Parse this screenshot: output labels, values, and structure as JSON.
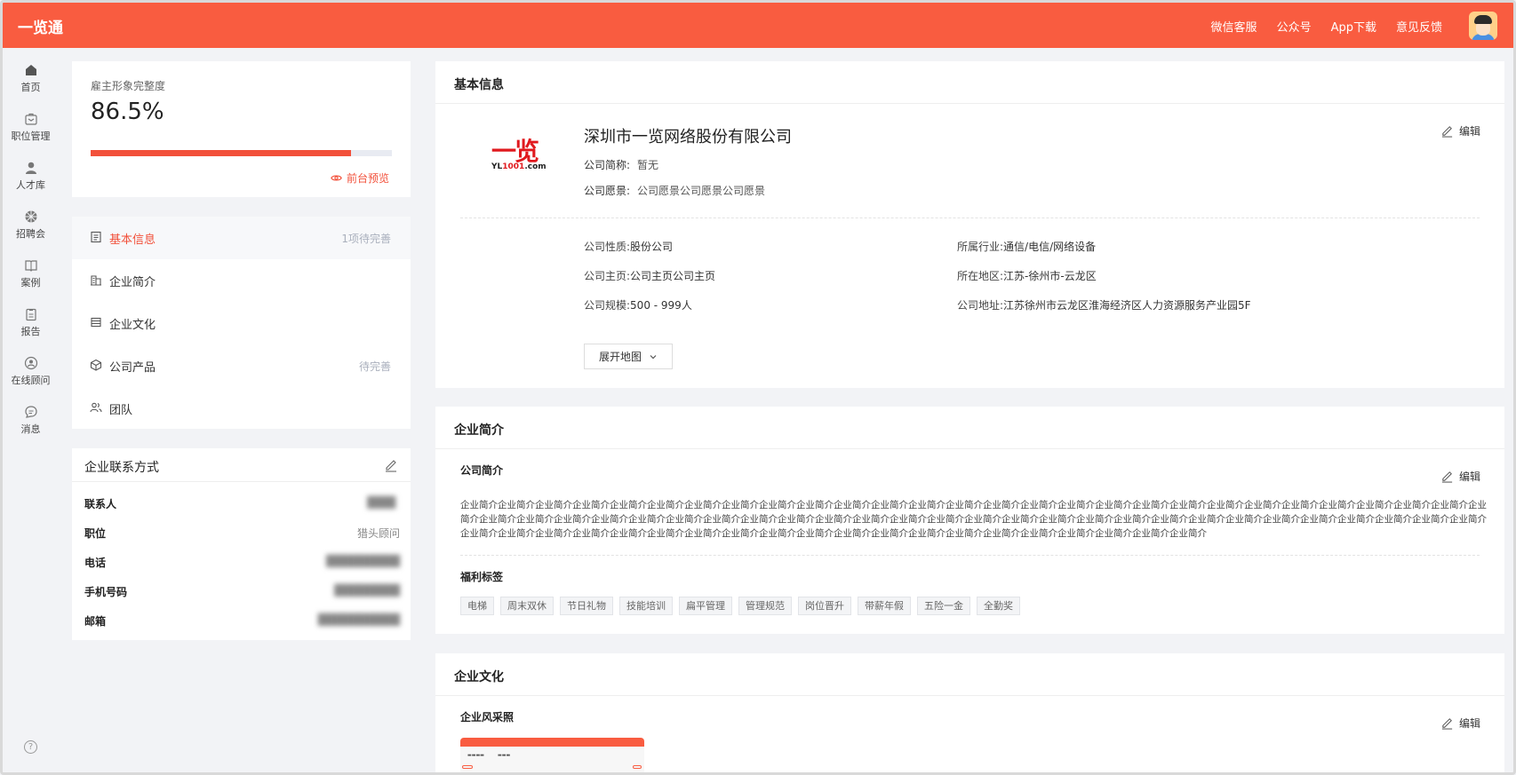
{
  "app": {
    "title": "一览通"
  },
  "header": {
    "links": [
      "微信客服",
      "公众号",
      "App下载",
      "意见反馈"
    ]
  },
  "leftnav": {
    "items": [
      {
        "label": "首页",
        "icon": "home-icon"
      },
      {
        "label": "职位管理",
        "icon": "briefcase-icon"
      },
      {
        "label": "人才库",
        "icon": "person-icon"
      },
      {
        "label": "招聘会",
        "icon": "fair-icon"
      },
      {
        "label": "案例",
        "icon": "book-icon"
      },
      {
        "label": "报告",
        "icon": "report-icon"
      },
      {
        "label": "在线顾问",
        "icon": "advisor-icon"
      },
      {
        "label": "消息",
        "icon": "message-icon"
      }
    ],
    "help": "?"
  },
  "completeness": {
    "label": "雇主形象完整度",
    "value": "86.5%",
    "fraction": 0.865,
    "preview_label": "前台预览"
  },
  "menu": {
    "items": [
      {
        "label": "基本信息",
        "status": "1项待完善",
        "active": true
      },
      {
        "label": "企业简介",
        "status": ""
      },
      {
        "label": "企业文化",
        "status": ""
      },
      {
        "label": "公司产品",
        "status": "待完善"
      },
      {
        "label": "团队",
        "status": ""
      }
    ]
  },
  "contact": {
    "title": "企业联系方式",
    "rows": [
      {
        "key": "联系人",
        "value": ""
      },
      {
        "key": "职位",
        "value": "猎头顾问"
      },
      {
        "key": "电话",
        "value": ""
      },
      {
        "key": "手机号码",
        "value": ""
      },
      {
        "key": "邮箱",
        "value": ""
      }
    ]
  },
  "basic": {
    "title": "基本信息",
    "logo_big": "一览",
    "logo_small_a": "YL",
    "logo_small_b": "1001",
    "logo_small_c": ".com",
    "company_name": "深圳市一览网络股份有限公司",
    "short_name_key": "公司简称:",
    "short_name_value": "暂无",
    "vision_key": "公司愿景:",
    "vision_value": "公司愿景公司愿景公司愿景",
    "edit_label": "编辑",
    "fields": {
      "nature_key": "公司性质:",
      "nature_value": "股份公司",
      "industry_key": "所属行业:",
      "industry_value": "通信/电信/网络设备",
      "homepage_key": "公司主页:",
      "homepage_value": "公司主页公司主页",
      "region_key": "所在地区:",
      "region_value": "江苏-徐州市-云龙区",
      "scale_key": "公司规模:",
      "scale_value": "500 - 999人",
      "address_key": "公司地址:",
      "address_value": "江苏徐州市云龙区淮海经济区人力资源服务产业园5F"
    },
    "map_button": "展开地图"
  },
  "intro": {
    "title": "企业简介",
    "sub_title": "公司简介",
    "edit_label": "编辑",
    "text": "企业简介企业简介企业简介企业简介企业简介企业简介企业简介企业简介企业简介企业简介企业简介企业简介企业简介企业简介企业简介企业简介企业简介企业简介企业简介企业简介企业简介企业简介企业简介企业简介企业简介企业简介企业简介企业简介企业简介企业简介企业简介企业简介企业简介企业简介企业简介企业简介企业简介企业简介企业简介企业简介企业简介企业简介企业简介企业简介企业简介企业简介企业简介企业简介企业简介企业简介企业简介企业简介企业简介企业简介企业简介企业简介企业简介企业简介企业简介企业简介企业简介企业简介企业简介企业简介企业简介企业简介企业简介企业简介企业简介企业简介企业简介企业简介企业简介企业简介企业简介",
    "welfare_title": "福利标签",
    "tags": [
      "电梯",
      "周末双休",
      "节日礼物",
      "技能培训",
      "扁平管理",
      "管理规范",
      "岗位晋升",
      "带薪年假",
      "五险一金",
      "全勤奖"
    ]
  },
  "culture": {
    "title": "企业文化",
    "sub_title": "企业风采照",
    "edit_label": "编辑"
  },
  "colors": {
    "brand": "#f95c40",
    "accent": "#f2503a"
  }
}
